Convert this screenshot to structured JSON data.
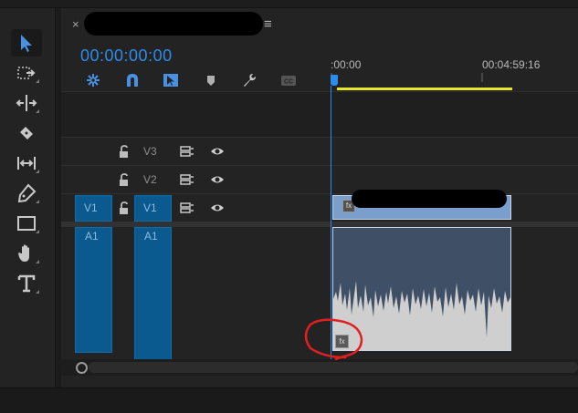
{
  "panel": {
    "close_label": "×",
    "menu_label": "≡",
    "timecode": "00:00:00:00"
  },
  "ruler": {
    "start_label": ":00:00",
    "end_label": "00:04:59:16"
  },
  "tracks": {
    "v3": {
      "label": "V3"
    },
    "v2": {
      "label": "V2"
    },
    "v1": {
      "source_label": "V1",
      "label": "V1"
    },
    "a1": {
      "source_label": "A1",
      "label": "A1"
    }
  },
  "clips": {
    "video_fx_badge": "fx",
    "audio_fx_badge": "fx"
  },
  "tools": [
    "selection-tool",
    "track-select-forward-tool",
    "ripple-edit-tool",
    "razor-tool",
    "slip-tool",
    "pen-tool",
    "rectangle-tool",
    "hand-tool",
    "type-tool"
  ],
  "header_icons": [
    "nest-sequence-icon",
    "snap-icon",
    "linked-selection-icon",
    "add-marker-icon",
    "timeline-settings-icon",
    "captions-icon"
  ],
  "colors": {
    "accent": "#2d8ceb",
    "work_area": "#e6e62a",
    "video_clip": "#7b9fcc",
    "audio_clip": "#3e4f66",
    "track_target": "#0a5a8f",
    "annotation": "#e02020"
  }
}
